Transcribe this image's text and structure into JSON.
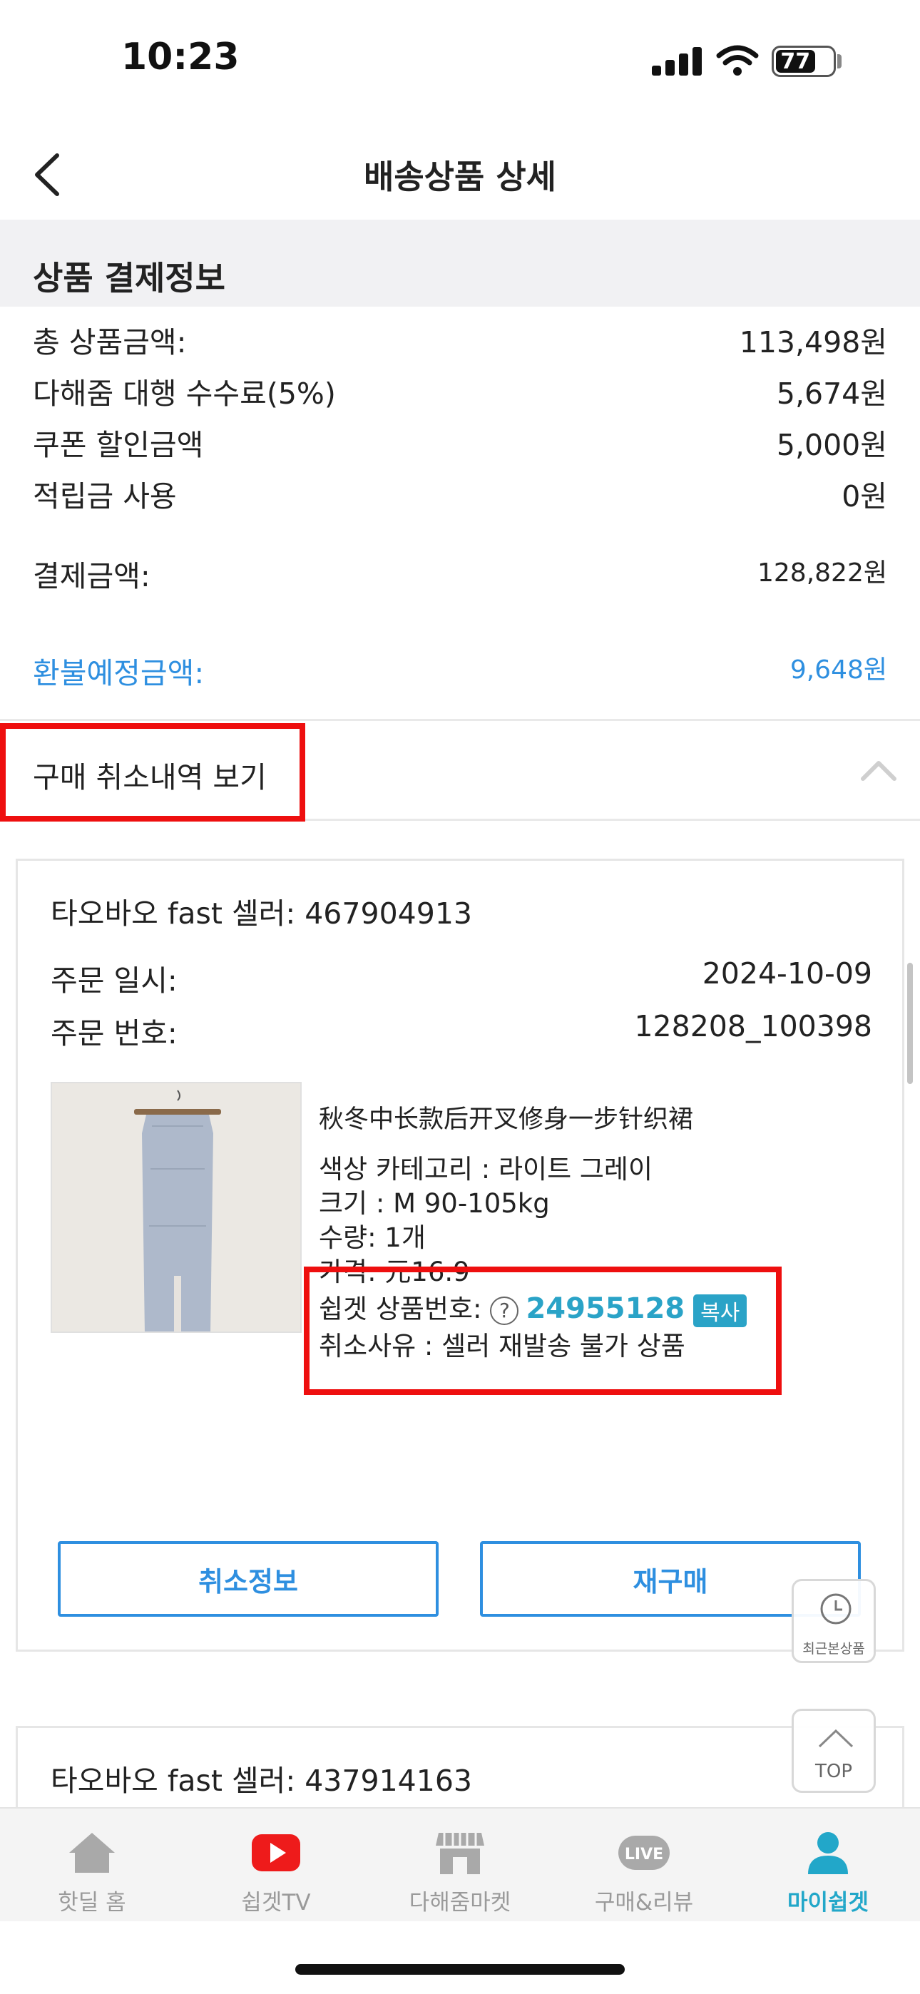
{
  "status_bar": {
    "time": "10:23",
    "battery": "77"
  },
  "header": {
    "title": "배송상품 상세"
  },
  "payment": {
    "section_title": "상품 결제정보",
    "rows": [
      {
        "label": "총 상품금액:",
        "value": "113,498원"
      },
      {
        "label": "다해줌 대행 수수료(5%)",
        "value": "5,674원"
      },
      {
        "label": "쿠폰 할인금액",
        "value": "5,000원"
      },
      {
        "label": "적립금 사용",
        "value": "0원"
      }
    ],
    "total_label": "결제금액:",
    "total_value": "128,822원",
    "refund_label": "환불예정금액:",
    "refund_value": "9,648원"
  },
  "cancel_history": {
    "toggle_label": "구매 취소내역 보기"
  },
  "order": {
    "seller": "타오바오 fast 셀러: 467904913",
    "date_label": "주문 일시:",
    "date_value": "2024-10-09",
    "number_label": "주문 번호:",
    "number_value": "128208_100398",
    "product": {
      "name": "秋冬中长款后开叉修身一步针织裙",
      "color": "색상 카테고리 : 라이트 그레이",
      "size": "크기 : M 90-105kg",
      "quantity": "수량: 1개",
      "price": "가격: 元16.9",
      "code_label": "쉽겟 상품번호:",
      "help": "?",
      "code_value": "24955128",
      "copy_label": "복사",
      "cancel_reason": "취소사유 : 셀러 재발송 불가 상품"
    },
    "buttons": {
      "cancel_info": "취소정보",
      "rebuy": "재구매"
    }
  },
  "next_order": {
    "seller": "타오바오 fast 셀러: 437914163"
  },
  "floating": {
    "recent_label": "최근본상품",
    "top_label": "TOP"
  },
  "tabs": [
    {
      "label": "핫딜 홈",
      "icon": "home-icon"
    },
    {
      "label": "쉽겟TV",
      "icon": "youtube-icon"
    },
    {
      "label": "다해줌마켓",
      "icon": "store-icon"
    },
    {
      "label": "구매&리뷰",
      "icon": "live-icon",
      "badge": "LIVE"
    },
    {
      "label": "마이쉽겟",
      "icon": "person-icon",
      "active": true
    }
  ],
  "colors": {
    "accent": "#2aa3c7",
    "blue": "#2e8fe0",
    "highlight": "#ee0f0f"
  }
}
